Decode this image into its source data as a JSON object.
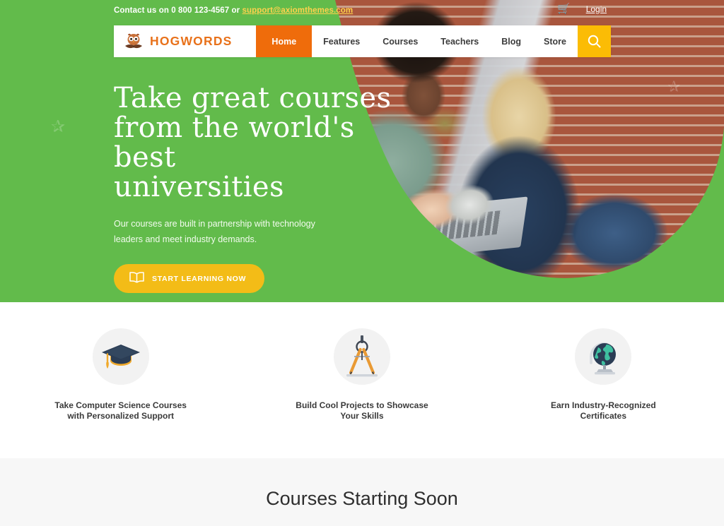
{
  "topbar": {
    "contact_prefix": "Contact us on 0 800 123-4567 or ",
    "email": "support@axiomthemes.com",
    "cart_icon": "shopping-cart-icon",
    "login_label": "Login"
  },
  "nav": {
    "brand": "HOGWORDS",
    "logo_icon": "owl-reading-book-icon",
    "items": [
      {
        "label": "Home",
        "active": true
      },
      {
        "label": "Features",
        "active": false
      },
      {
        "label": "Courses",
        "active": false
      },
      {
        "label": "Teachers",
        "active": false
      },
      {
        "label": "Blog",
        "active": false
      },
      {
        "label": "Store",
        "active": false
      }
    ],
    "search_icon": "search-icon"
  },
  "hero": {
    "title_line1": "Take great courses",
    "title_line2": "from the world's best",
    "title_line3": "universities",
    "subtitle": "Our courses are built in partnership with technology leaders and meet industry demands.",
    "cta_label": "START LEARNING NOW",
    "cta_icon": "open-book-icon",
    "photo_alt": "two students sitting outdoors with a laptop",
    "decor_star_icon": "star-icon"
  },
  "features": [
    {
      "icon": "graduation-cap-icon",
      "caption_line1": "Take Computer Science Courses",
      "caption_line2": "with Personalized Support"
    },
    {
      "icon": "drafting-compass-icon",
      "caption_line1": "Build Cool Projects to Showcase",
      "caption_line2": "Your Skills"
    },
    {
      "icon": "globe-icon",
      "caption_line1": "Earn Industry-Recognized",
      "caption_line2": "Certificates"
    }
  ],
  "courses_section": {
    "title": "Courses Starting Soon"
  },
  "colors": {
    "green": "#62bb4b",
    "orange": "#ef6c0b",
    "brand_orange": "#e8711a",
    "yellow": "#fbbc05",
    "cta_yellow": "#f3bc17",
    "light_gray": "#f7f7f7"
  }
}
